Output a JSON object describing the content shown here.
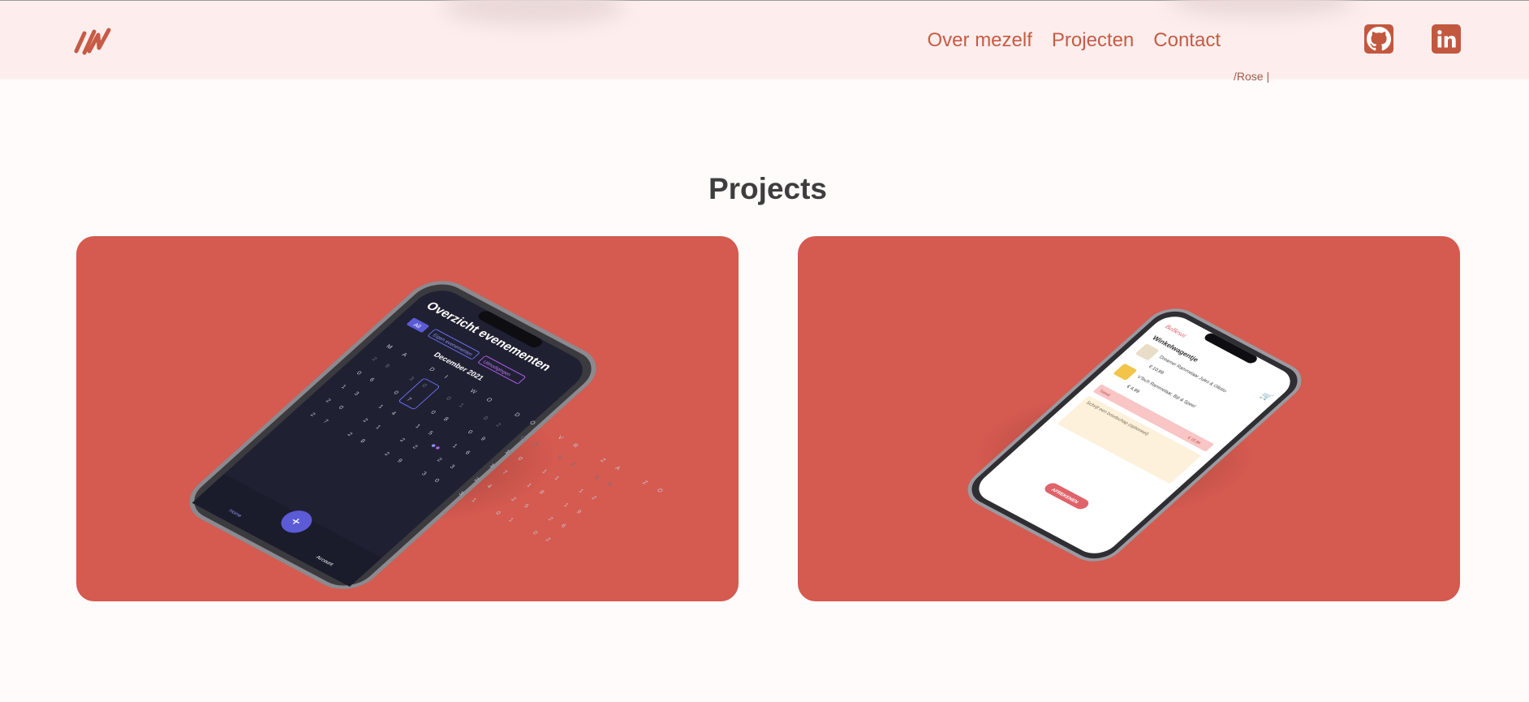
{
  "nav": {
    "items": [
      {
        "label": "Over mezelf"
      },
      {
        "label": "Projecten"
      },
      {
        "label": "Contact"
      }
    ]
  },
  "partial_text": "/Rose |",
  "projects": {
    "title": "Projects",
    "cards": [
      {
        "screen_title": "Overzicht evenementen",
        "chip_all": "All",
        "chip_mine": "Eigen evenementen",
        "chip_invites": "Uitnodigingen",
        "month": "December 2021",
        "weekdays": [
          "MA",
          "DI",
          "WO",
          "DO",
          "VR",
          "ZA",
          "ZO"
        ],
        "week1": [
          "29",
          "30",
          "01",
          "02",
          "03",
          "04",
          "05"
        ],
        "week2": [
          "06",
          "07",
          "08",
          "09",
          "10",
          "11",
          "12"
        ],
        "week3": [
          "13",
          "14",
          "15",
          "16",
          "17",
          "18",
          "19"
        ],
        "week4": [
          "20",
          "21",
          "22",
          "23",
          "24",
          "25",
          "26"
        ],
        "week5": [
          "27",
          "28",
          "29",
          "30",
          "31",
          "01",
          "02"
        ],
        "tab_home": "Home",
        "tab_account": "Account"
      },
      {
        "brand": "BoBesai",
        "heading": "Winkelwagentje",
        "item1_name": "Dreamer Rammelaar Jules & Ollotto",
        "item1_price": "€ 10,99",
        "item2_name": "VTech Rammelaar, Bijt & Speel",
        "item2_price": "€ 4,99",
        "total_label": "Totaal:",
        "total_value": "€ 15,98",
        "message_placeholder": "Schrijf een boodschap (optioneel)",
        "button_label": "AFREKENEN"
      }
    ]
  },
  "colors": {
    "accent": "#c75b45",
    "card_bg": "#d55a50",
    "header_bg": "#fdeeed",
    "page_bg": "#fffbfb"
  },
  "icons": [
    "logo-mark",
    "github-icon",
    "linkedin-icon"
  ]
}
